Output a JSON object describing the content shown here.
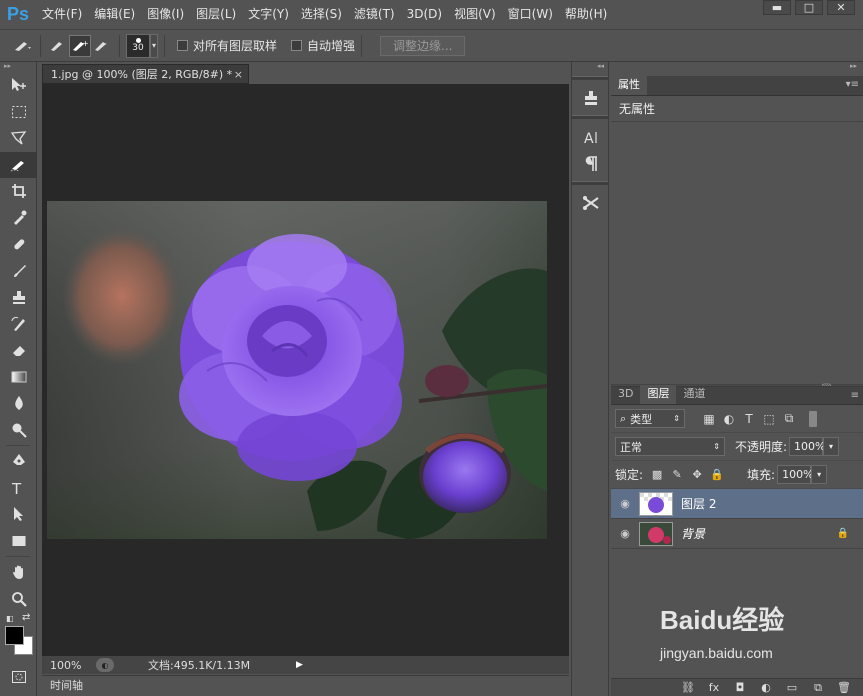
{
  "app": {
    "logo": "Ps"
  },
  "menu": [
    "文件(F)",
    "编辑(E)",
    "图像(I)",
    "图层(L)",
    "文字(Y)",
    "选择(S)",
    "滤镜(T)",
    "3D(D)",
    "视图(V)",
    "窗口(W)",
    "帮助(H)"
  ],
  "window_controls": {
    "minimize": "▬",
    "maximize": "□",
    "close": "✕"
  },
  "options": {
    "brush_size": "30",
    "sample_all_label": "对所有图层取样",
    "auto_enhance_label": "自动增强",
    "refine_edge_label": "调整边缘..."
  },
  "document": {
    "tab_title": "1.jpg @ 100% (图层 2, RGB/8#) *",
    "close": "×"
  },
  "status": {
    "zoom": "100%",
    "doc_info": "文档:495.1K/1.13M"
  },
  "timeline": {
    "label": "时间轴"
  },
  "properties": {
    "tab": "属性",
    "content": "无属性"
  },
  "layers": {
    "tabs": [
      "3D",
      "图层",
      "通道"
    ],
    "filter_kind": "类型",
    "blend_mode": "正常",
    "opacity_label": "不透明度:",
    "opacity_value": "100%",
    "lock_label": "锁定:",
    "fill_label": "填充:",
    "fill_value": "100%",
    "items": [
      {
        "name": "图层 2",
        "selected": true
      },
      {
        "name": "背景",
        "selected": false,
        "locked": true
      }
    ]
  },
  "watermark": {
    "brand": "Baidu经验",
    "url": "jingyan.baidu.com"
  },
  "colors": {
    "accent": "#3aa0e6",
    "flower": "#8a55e6",
    "selection": "#5e6f89"
  }
}
